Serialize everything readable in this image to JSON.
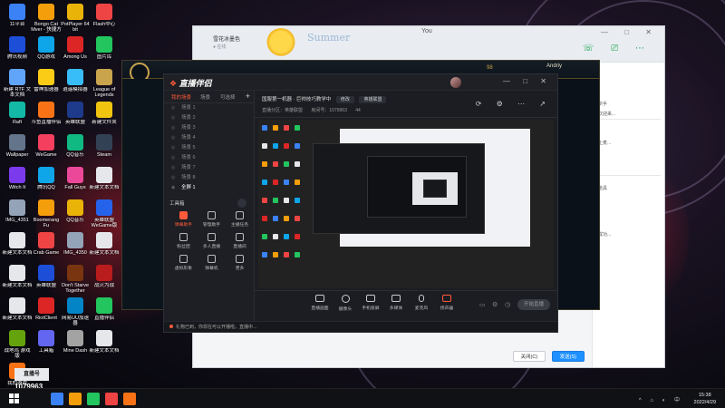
{
  "desktop": {
    "icons": [
      {
        "label": "11平台",
        "color": "#3b82f6"
      },
      {
        "label": "Bongo Cat Mver - 快捷方式",
        "color": "#f59e0b"
      },
      {
        "label": "PotPlayer 64 bit",
        "color": "#eab308"
      },
      {
        "label": "Flash中心",
        "color": "#ef4444"
      },
      {
        "label": "腾讯视频",
        "color": "#1d4ed8"
      },
      {
        "label": "QQ游戏",
        "color": "#0ea5e9"
      },
      {
        "label": "Among Us",
        "color": "#dc2626"
      },
      {
        "label": "图片库",
        "color": "#22c55e"
      },
      {
        "label": "新建 RTF 文本文档",
        "color": "#60a5fa"
      },
      {
        "label": "雷神加速器",
        "color": "#facc15"
      },
      {
        "label": "逍遥模拟器",
        "color": "#38bdf8"
      },
      {
        "label": "League of Legends",
        "color": "#c9a44d"
      },
      {
        "label": "Raft",
        "color": "#14b8a6"
      },
      {
        "label": "斗鱼直播伴侣",
        "color": "#f97316"
      },
      {
        "label": "英雄联盟",
        "color": "#1e3a8a"
      },
      {
        "label": "新建文件夹",
        "color": "#f1c40f"
      },
      {
        "label": "Wallpaper",
        "color": "#64748b"
      },
      {
        "label": "WeGame",
        "color": "#f43f5e"
      },
      {
        "label": "QQ音乐",
        "color": "#10b981"
      },
      {
        "label": "Steam",
        "color": "#334155"
      },
      {
        "label": "Witch It",
        "color": "#7c3aed"
      },
      {
        "label": "腾讯QQ",
        "color": "#0ea5e9"
      },
      {
        "label": "Fall Guys",
        "color": "#ec4899"
      },
      {
        "label": "新建文本文档",
        "color": "#e5e7eb"
      },
      {
        "label": "IMG_4351",
        "color": "#94a3b8"
      },
      {
        "label": "Boomerang Fu",
        "color": "#f59e0b"
      },
      {
        "label": "QQ音乐",
        "color": "#eab308"
      },
      {
        "label": "英雄联盟WeGame版",
        "color": "#2563eb"
      },
      {
        "label": "新建文本文档",
        "color": "#e5e7eb"
      },
      {
        "label": "Crab Game",
        "color": "#ef4444"
      },
      {
        "label": "IMG_4350",
        "color": "#94a3b8"
      },
      {
        "label": "新建文本文档",
        "color": "#e5e7eb"
      },
      {
        "label": "新建文本文档",
        "color": "#e5e7eb"
      },
      {
        "label": "英雄联盟",
        "color": "#1d4ed8"
      },
      {
        "label": "Don't Starve Together",
        "color": "#78350f"
      },
      {
        "label": "战火为战",
        "color": "#b91c1c"
      },
      {
        "label": "新建文本文档",
        "color": "#e5e7eb"
      },
      {
        "label": "RiotClient",
        "color": "#dc2626"
      },
      {
        "label": "网易UU加速器",
        "color": "#0284c7"
      },
      {
        "label": "直播伴侣",
        "color": "#22c55e"
      },
      {
        "label": "战地鸡 游戏版",
        "color": "#65a30d"
      },
      {
        "label": "工具箱",
        "color": "#6366f1"
      },
      {
        "label": "Mine Dash",
        "color": "#a3a3a3"
      },
      {
        "label": "新建文本文档",
        "color": "#e5e7eb"
      },
      {
        "label": "我的游戏",
        "color": "#f97316"
      }
    ]
  },
  "qq_window": {
    "contact_name": "雪花冰墨色",
    "contact_sub": "● 在线",
    "banner": "Summer",
    "title": "You",
    "controls": "— □ ✕",
    "header_icons": "☏ ⎚ ⋯",
    "side_lines": [
      "新手",
      "欢迎来...",
      "上麦...",
      "道具",
      "",
      "成功..."
    ],
    "close_label": "关闭(C)",
    "send_label": "发送(S)"
  },
  "lol_window": {
    "rp": "98",
    "username": "Andriy"
  },
  "app": {
    "logo": "直播伴侣",
    "window_controls": "— □ ✕",
    "scene_tabs": [
      "我的场景",
      "场景",
      "可选择"
    ],
    "scenes": [
      "场景 1",
      "场景 2",
      "场景 3",
      "场景 4",
      "场景 5",
      "场景 6",
      "场景 7",
      "场景 8"
    ],
    "active_scene": "全屏 1",
    "tools_title": "工具箱",
    "tools": [
      {
        "label": "弹幕助手",
        "hot": true
      },
      {
        "label": "管理助手",
        "hot": false
      },
      {
        "label": "主播任务",
        "hot": false
      },
      {
        "label": "粉丝团",
        "hot": false
      },
      {
        "label": "多人直播",
        "hot": false
      },
      {
        "label": "直播间",
        "hot": false
      },
      {
        "label": "虚拟形象",
        "hot": false
      },
      {
        "label": "弹幕机",
        "hot": false
      },
      {
        "label": "更多",
        "hot": false
      }
    ],
    "room_title": "国服第一机器 · 巨帅技巧教学中",
    "edit_chip": "修改",
    "category_chip": "英雄联盟",
    "meta": [
      "直播分区：英雄联盟",
      "房间号：1079963",
      "44"
    ],
    "right_icons": "⟳ ⚙ ⋯ ↗",
    "bottom_buttons": [
      {
        "label": "直播画面"
      },
      {
        "label": "摄像头"
      },
      {
        "label": "手机投屏"
      },
      {
        "label": "多媒体"
      },
      {
        "label": "麦克风"
      },
      {
        "label": "扬声器"
      }
    ],
    "go_live": "开始直播",
    "status": "礼物已到，你现在可以开播啦，直播中..."
  },
  "overlay": {
    "logo": "直播号",
    "number": "1079963"
  },
  "taskbar": {
    "tray": "^ ⌂ ◐ 中",
    "time": "15:38",
    "date": "2022/4/29",
    "apps": [
      "#3b82f6",
      "#f59e0b",
      "#22c55e",
      "#ef4444",
      "#f97316"
    ]
  }
}
